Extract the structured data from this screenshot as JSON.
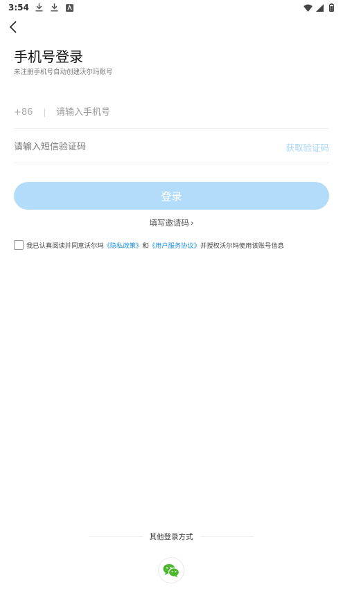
{
  "status_bar": {
    "time": "3:54",
    "left_icons": [
      "download-icon",
      "download-icon",
      "notification-icon"
    ],
    "right_icons": [
      "wifi-icon",
      "signal-icon",
      "battery-icon"
    ]
  },
  "header": {
    "title": "手机号登录",
    "subtitle": "未注册手机号自动创建沃尔玛账号"
  },
  "phone_field": {
    "country_code": "+86",
    "placeholder": "请输入手机号",
    "value": ""
  },
  "code_field": {
    "placeholder": "请输入短信验证码",
    "value": "",
    "get_code_label": "获取验证码"
  },
  "login_button": {
    "label": "登录"
  },
  "invite": {
    "label": "填写邀请码",
    "chevron": "›"
  },
  "agreement": {
    "checked": false,
    "prefix": "我已认真阅读并同意沃尔玛",
    "privacy_link": "《隐私政策》",
    "and": "和",
    "service_link": "《用户服务协议》",
    "suffix": "并授权沃尔玛使用该账号信息"
  },
  "other_login": {
    "label": "其他登录方式",
    "methods": [
      "wechat-icon"
    ]
  },
  "colors": {
    "accent": "#1a8fe6",
    "button_disabled": "#b3dcfb",
    "get_code_disabled": "#a9d6f9",
    "wechat_green": "#4cb82e"
  }
}
